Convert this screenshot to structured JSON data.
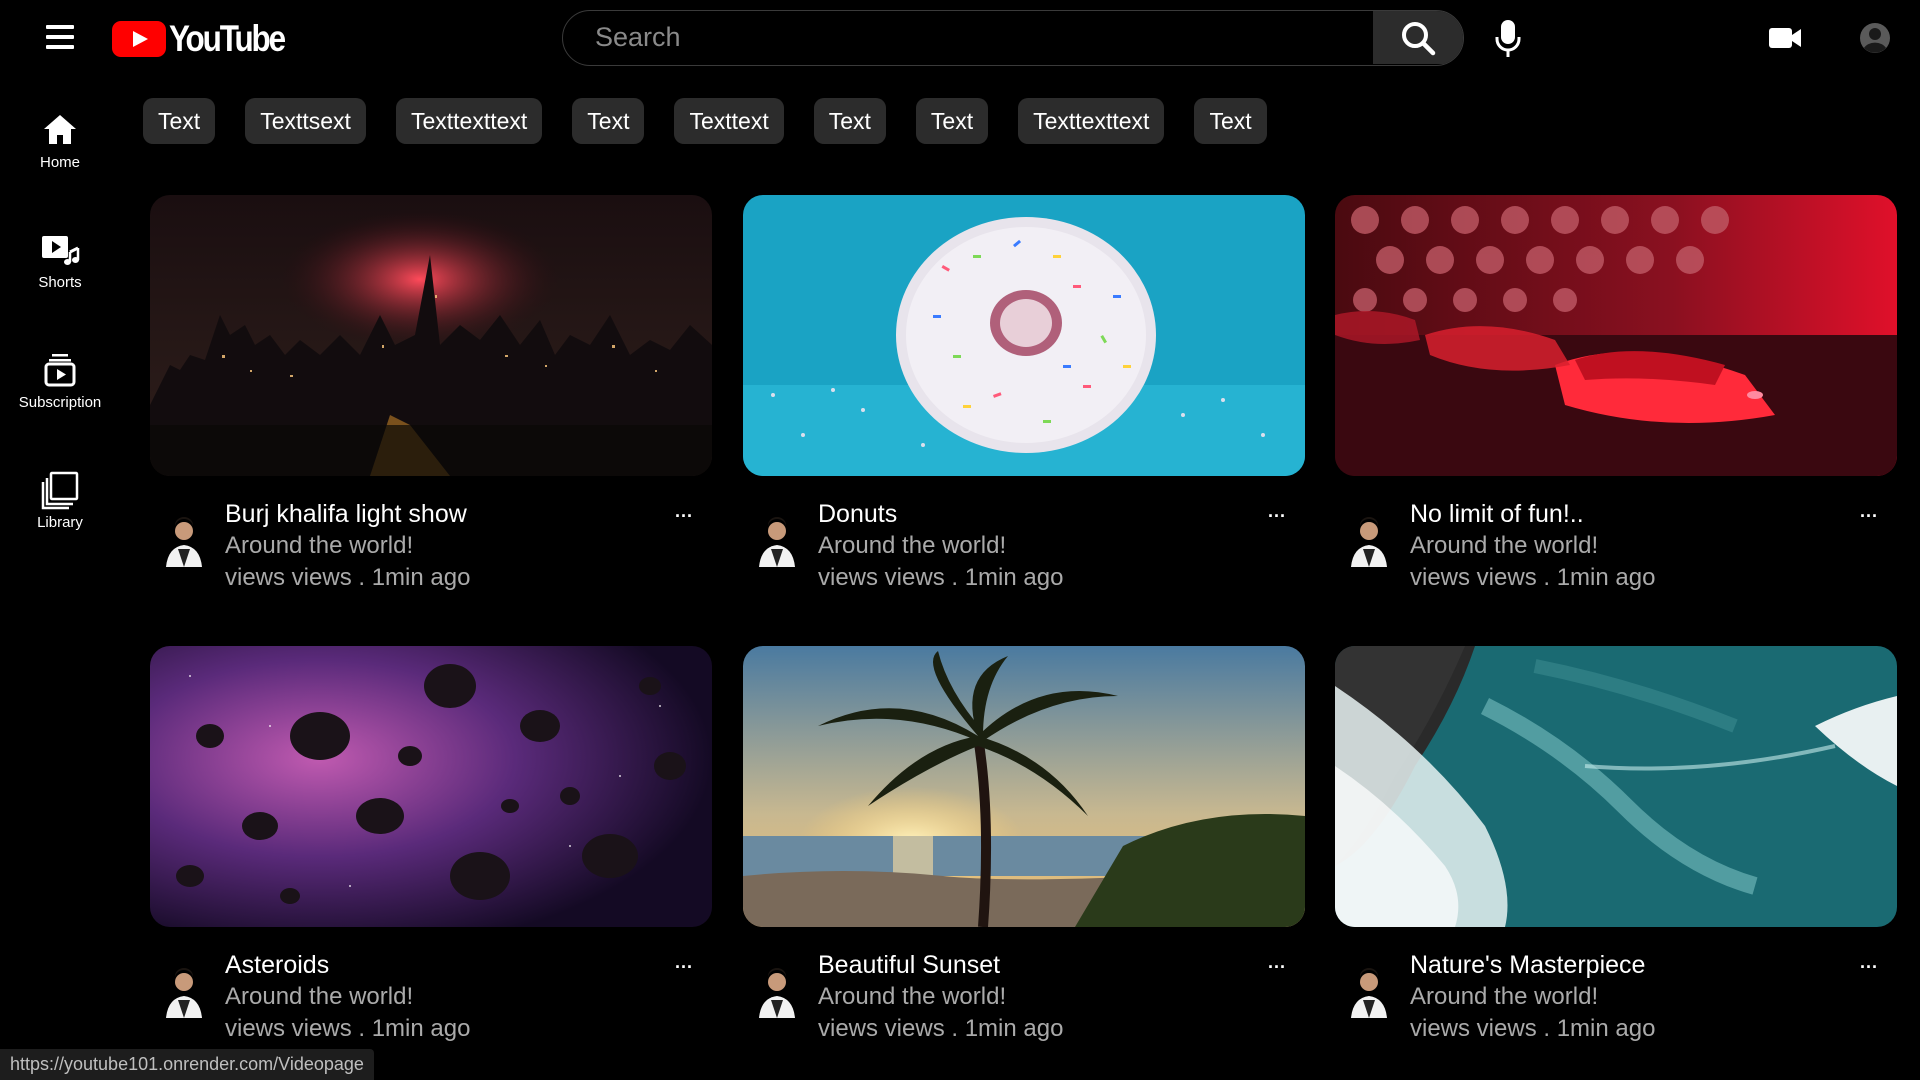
{
  "header": {
    "logo_text": "YouTube",
    "search_placeholder": "Search"
  },
  "sidebar": {
    "items": [
      {
        "label": "Home",
        "icon": "home-icon"
      },
      {
        "label": "Shorts",
        "icon": "shorts-icon"
      },
      {
        "label": "Subscription",
        "icon": "subscriptions-icon"
      },
      {
        "label": "Library",
        "icon": "library-icon"
      }
    ]
  },
  "chips": [
    "Text",
    "Texttsext",
    "Texttexttext",
    "Text",
    "Texttext",
    "Text",
    "Text",
    "Texttexttext",
    "Text"
  ],
  "videos": [
    {
      "title": "Burj khalifa light show",
      "channel": "Around the world!",
      "meta": "views views . 1min ago",
      "thumbnail": "city-night-fireworks"
    },
    {
      "title": "Donuts",
      "channel": "Around the world!",
      "meta": "views views . 1min ago",
      "thumbnail": "sprinkled-donut"
    },
    {
      "title": "No limit of fun!..",
      "channel": "Around the world!",
      "meta": "views views . 1min ago",
      "thumbnail": "red-bumper-cars"
    },
    {
      "title": "Asteroids",
      "channel": "Around the world!",
      "meta": "views views . 1min ago",
      "thumbnail": "asteroid-field"
    },
    {
      "title": "Beautiful Sunset",
      "channel": "Around the world!",
      "meta": "views views . 1min ago",
      "thumbnail": "palm-tree-sunset"
    },
    {
      "title": "Nature's Masterpiece",
      "channel": "Around the world!",
      "meta": "views views . 1min ago",
      "thumbnail": "ocean-waves-aerial"
    }
  ],
  "more_label": "...",
  "status_bar": "https://youtube101.onrender.com/Videopage",
  "colors": {
    "background": "#000000",
    "brand_red": "#ff0000",
    "chip_bg": "#2c2c2c",
    "secondary_text": "#aaaaaa"
  }
}
